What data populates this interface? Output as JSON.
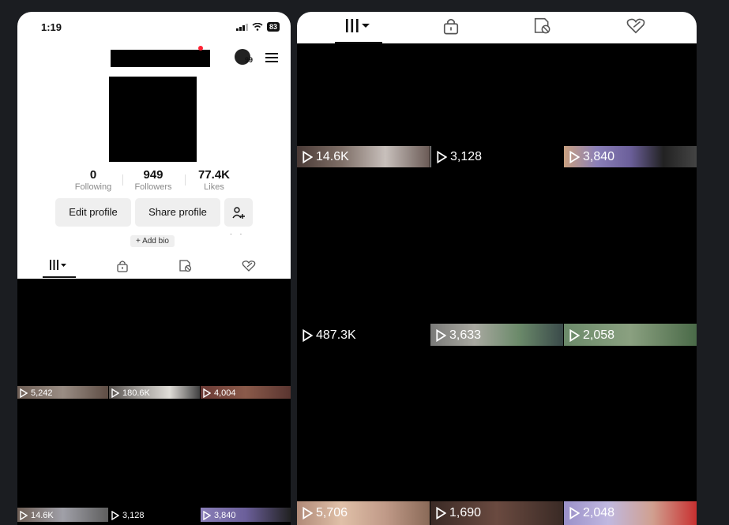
{
  "status": {
    "time": "1:19",
    "battery": "83"
  },
  "profile": {
    "avatar_badge": "99",
    "stats": [
      {
        "value": "0",
        "label": "Following"
      },
      {
        "value": "949",
        "label": "Followers"
      },
      {
        "value": "77.4K",
        "label": "Likes"
      }
    ],
    "buttons": {
      "edit": "Edit profile",
      "share": "Share profile"
    },
    "add_bio": "+ Add bio"
  },
  "tabs": [
    "videos-grid-icon",
    "lock-icon",
    "hidden-icon",
    "liked-icon"
  ],
  "left_grid": {
    "row1_views": [
      "5,242",
      "180.6K",
      "4,004"
    ],
    "row2_views": [
      "14.6K",
      "3,128",
      "3,840"
    ]
  },
  "right_grid": {
    "row1_views": [
      "14.6K",
      "3,128",
      "3,840"
    ],
    "row2_views": [
      "487.3K",
      "3,633",
      "2,058"
    ],
    "row3_views": [
      "5,706",
      "1,690",
      "2,048"
    ]
  },
  "colors": {
    "background": "#1b1d21",
    "tile_tint_a": "#6e5e55",
    "tile_tint_b": "#8a7fb8",
    "tile_tint_c": "#6b8a6a"
  }
}
